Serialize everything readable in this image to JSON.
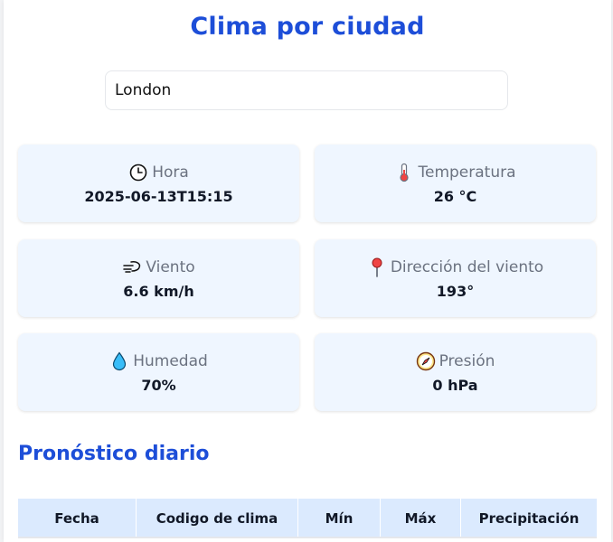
{
  "page": {
    "title": "Clima por ciudad"
  },
  "search": {
    "value": "London"
  },
  "stats": {
    "hora": {
      "label": "Hora",
      "value": "2025-06-13T15:15",
      "icon": "clock-icon"
    },
    "temperatura": {
      "label": "Temperatura",
      "value": "26 °C",
      "icon": "thermometer-icon"
    },
    "viento": {
      "label": "Viento",
      "value": "6.6 km/h",
      "icon": "wind-icon"
    },
    "direccion": {
      "label": "Dirección del viento",
      "value": "193°",
      "icon": "pin-icon"
    },
    "humedad": {
      "label": "Humedad",
      "value": "70%",
      "icon": "droplet-icon"
    },
    "presion": {
      "label": "Presión",
      "value": "0 hPa",
      "icon": "compass-icon"
    }
  },
  "forecast": {
    "title": "Pronóstico diario",
    "columns": [
      "Fecha",
      "Codigo de clima",
      "Mín",
      "Máx",
      "Precipitación"
    ]
  },
  "colors": {
    "accent": "#1d4ed8",
    "card_bg": "#eff6ff",
    "table_header_bg": "#dbeafe"
  }
}
